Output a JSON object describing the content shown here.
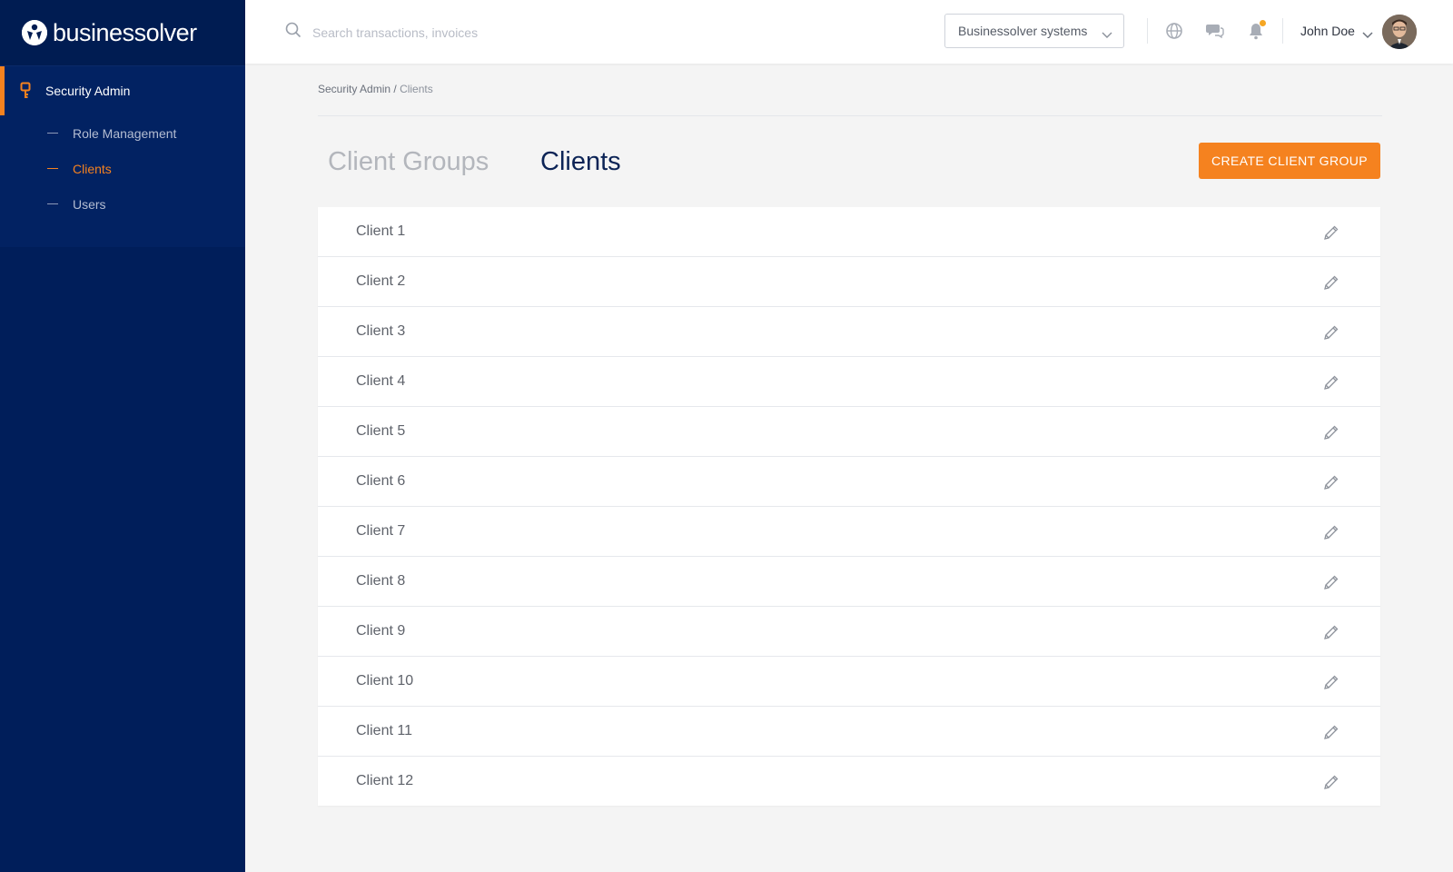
{
  "brand": {
    "name": "businessolver"
  },
  "sidebar": {
    "section_label": "Security Admin",
    "items": [
      {
        "label": "Role Management",
        "active": false
      },
      {
        "label": "Clients",
        "active": true
      },
      {
        "label": "Users",
        "active": false
      }
    ]
  },
  "header": {
    "search_placeholder": "Search transactions, invoices",
    "system_select_value": "Businessolver systems",
    "user_name": "John Doe"
  },
  "breadcrumb": {
    "parent": "Security Admin",
    "separator": " / ",
    "current": "Clients"
  },
  "tabs": {
    "groups_label": "Client Groups",
    "clients_label": "Clients"
  },
  "create_button_label": "CREATE CLIENT GROUP",
  "clients": [
    "Client 1",
    "Client 2",
    "Client 3",
    "Client 4",
    "Client 5",
    "Client 6",
    "Client 7",
    "Client 8",
    "Client 9",
    "Client 10",
    "Client 11",
    "Client 12"
  ],
  "colors": {
    "sidebar": "#001e5a",
    "accent": "#f5821f",
    "title": "#0c2456"
  }
}
